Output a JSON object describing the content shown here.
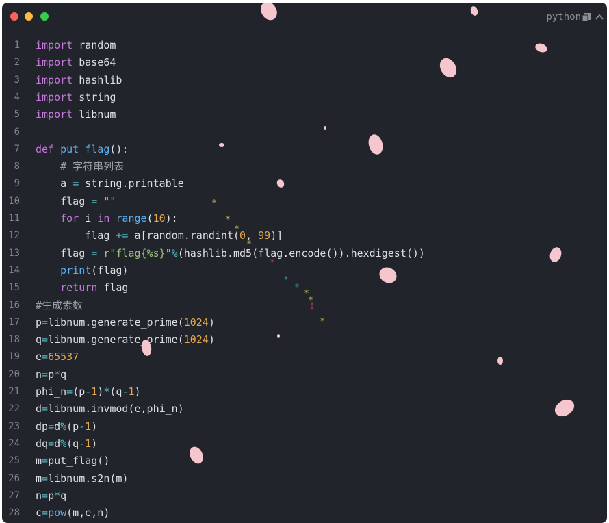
{
  "window": {
    "language_label": "python",
    "icons": [
      "close-dot",
      "minimize-dot",
      "maximize-dot",
      "copy-icon",
      "chevron-up-icon"
    ]
  },
  "code": {
    "lines": [
      {
        "n": "1",
        "tokens": [
          [
            "kw",
            "import"
          ],
          [
            "plain",
            " random"
          ]
        ]
      },
      {
        "n": "2",
        "tokens": [
          [
            "kw",
            "import"
          ],
          [
            "plain",
            " base64"
          ]
        ]
      },
      {
        "n": "3",
        "tokens": [
          [
            "kw",
            "import"
          ],
          [
            "plain",
            " hashlib"
          ]
        ]
      },
      {
        "n": "4",
        "tokens": [
          [
            "kw",
            "import"
          ],
          [
            "plain",
            " string"
          ]
        ]
      },
      {
        "n": "5",
        "tokens": [
          [
            "kw",
            "import"
          ],
          [
            "plain",
            " libnum"
          ]
        ]
      },
      {
        "n": "6",
        "tokens": []
      },
      {
        "n": "7",
        "tokens": [
          [
            "kw",
            "def"
          ],
          [
            "plain",
            " "
          ],
          [
            "fn",
            "put_flag"
          ],
          [
            "plain",
            "():"
          ]
        ]
      },
      {
        "n": "8",
        "tokens": [
          [
            "plain",
            "    "
          ],
          [
            "cm",
            "# 字符串列表"
          ]
        ]
      },
      {
        "n": "9",
        "tokens": [
          [
            "plain",
            "    a "
          ],
          [
            "op",
            "="
          ],
          [
            "plain",
            " string.printable"
          ]
        ]
      },
      {
        "n": "10",
        "tokens": [
          [
            "plain",
            "    flag "
          ],
          [
            "op",
            "="
          ],
          [
            "plain",
            " "
          ],
          [
            "str",
            "\"\""
          ]
        ]
      },
      {
        "n": "11",
        "tokens": [
          [
            "plain",
            "    "
          ],
          [
            "kw",
            "for"
          ],
          [
            "plain",
            " i "
          ],
          [
            "kw",
            "in"
          ],
          [
            "plain",
            " "
          ],
          [
            "fn",
            "range"
          ],
          [
            "plain",
            "("
          ],
          [
            "num",
            "10"
          ],
          [
            "plain",
            "):"
          ]
        ]
      },
      {
        "n": "12",
        "tokens": [
          [
            "plain",
            "        flag "
          ],
          [
            "op",
            "+="
          ],
          [
            "plain",
            " a[random.randint("
          ],
          [
            "num",
            "0"
          ],
          [
            "plain",
            ", "
          ],
          [
            "num",
            "99"
          ],
          [
            "plain",
            ")]"
          ]
        ]
      },
      {
        "n": "13",
        "tokens": [
          [
            "plain",
            "    flag "
          ],
          [
            "op",
            "="
          ],
          [
            "plain",
            " "
          ],
          [
            "str",
            "r\"flag{%s}\""
          ],
          [
            "op",
            "%"
          ],
          [
            "plain",
            "(hashlib.md5(flag.encode()).hexdigest())"
          ]
        ]
      },
      {
        "n": "14",
        "tokens": [
          [
            "plain",
            "    "
          ],
          [
            "fn",
            "print"
          ],
          [
            "plain",
            "(flag)"
          ]
        ]
      },
      {
        "n": "15",
        "tokens": [
          [
            "plain",
            "    "
          ],
          [
            "kw",
            "return"
          ],
          [
            "plain",
            " flag"
          ]
        ]
      },
      {
        "n": "16",
        "tokens": [
          [
            "cm",
            "#生成素数"
          ]
        ]
      },
      {
        "n": "17",
        "tokens": [
          [
            "plain",
            "p"
          ],
          [
            "op",
            "="
          ],
          [
            "plain",
            "libnum.generate_prime("
          ],
          [
            "num",
            "1024"
          ],
          [
            "plain",
            ")"
          ]
        ]
      },
      {
        "n": "18",
        "tokens": [
          [
            "plain",
            "q"
          ],
          [
            "op",
            "="
          ],
          [
            "plain",
            "libnum.generate_prime("
          ],
          [
            "num",
            "1024"
          ],
          [
            "plain",
            ")"
          ]
        ]
      },
      {
        "n": "19",
        "tokens": [
          [
            "plain",
            "e"
          ],
          [
            "op",
            "="
          ],
          [
            "num",
            "65537"
          ]
        ]
      },
      {
        "n": "20",
        "tokens": [
          [
            "plain",
            "n"
          ],
          [
            "op",
            "="
          ],
          [
            "plain",
            "p"
          ],
          [
            "op",
            "*"
          ],
          [
            "plain",
            "q"
          ]
        ]
      },
      {
        "n": "21",
        "tokens": [
          [
            "plain",
            "phi_n"
          ],
          [
            "op",
            "="
          ],
          [
            "plain",
            "(p"
          ],
          [
            "op",
            "-"
          ],
          [
            "num",
            "1"
          ],
          [
            "plain",
            ")"
          ],
          [
            "op",
            "*"
          ],
          [
            "plain",
            "(q"
          ],
          [
            "op",
            "-"
          ],
          [
            "num",
            "1"
          ],
          [
            "plain",
            ")"
          ]
        ]
      },
      {
        "n": "22",
        "tokens": [
          [
            "plain",
            "d"
          ],
          [
            "op",
            "="
          ],
          [
            "plain",
            "libnum.invmod(e,phi_n)"
          ]
        ]
      },
      {
        "n": "23",
        "tokens": [
          [
            "plain",
            "dp"
          ],
          [
            "op",
            "="
          ],
          [
            "plain",
            "d"
          ],
          [
            "op",
            "%"
          ],
          [
            "plain",
            "(p"
          ],
          [
            "op",
            "-"
          ],
          [
            "num",
            "1"
          ],
          [
            "plain",
            ")"
          ]
        ]
      },
      {
        "n": "24",
        "tokens": [
          [
            "plain",
            "dq"
          ],
          [
            "op",
            "="
          ],
          [
            "plain",
            "d"
          ],
          [
            "op",
            "%"
          ],
          [
            "plain",
            "(q"
          ],
          [
            "op",
            "-"
          ],
          [
            "num",
            "1"
          ],
          [
            "plain",
            ")"
          ]
        ]
      },
      {
        "n": "25",
        "tokens": [
          [
            "plain",
            "m"
          ],
          [
            "op",
            "="
          ],
          [
            "plain",
            "put_flag()"
          ]
        ]
      },
      {
        "n": "26",
        "tokens": [
          [
            "plain",
            "m"
          ],
          [
            "op",
            "="
          ],
          [
            "plain",
            "libnum.s2n(m)"
          ]
        ]
      },
      {
        "n": "27",
        "tokens": [
          [
            "plain",
            "n"
          ],
          [
            "op",
            "="
          ],
          [
            "plain",
            "p"
          ],
          [
            "op",
            "*"
          ],
          [
            "plain",
            "q"
          ]
        ]
      },
      {
        "n": "28",
        "tokens": [
          [
            "plain",
            "c"
          ],
          [
            "op",
            "="
          ],
          [
            "fn",
            "pow"
          ],
          [
            "plain",
            "(m,e,n)"
          ]
        ]
      }
    ]
  }
}
